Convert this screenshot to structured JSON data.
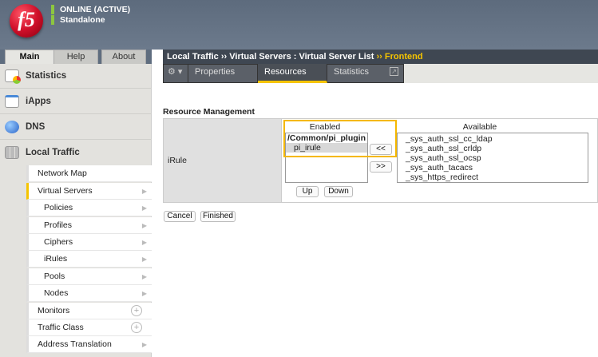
{
  "header": {
    "logo": "f5",
    "status": "ONLINE (ACTIVE)",
    "mode": "Standalone",
    "status_color": "#8dc63f"
  },
  "main_tabs": [
    "Main",
    "Help",
    "About"
  ],
  "sidebar": {
    "sections": [
      "Statistics",
      "iApps",
      "DNS",
      "Local Traffic"
    ],
    "local_traffic_items": [
      {
        "label": "Network Map"
      },
      {
        "label": "Virtual Servers"
      },
      {
        "label": "Policies"
      },
      {
        "label": "Profiles"
      },
      {
        "label": "Ciphers"
      },
      {
        "label": "iRules"
      },
      {
        "label": "Pools"
      },
      {
        "label": "Nodes"
      },
      {
        "label": "Monitors"
      },
      {
        "label": "Traffic Class"
      },
      {
        "label": "Address Translation"
      }
    ]
  },
  "breadcrumb": {
    "part1": "Local Traffic",
    "sep": "››",
    "part2": "Virtual Servers : Virtual Server List",
    "current": "Frontend"
  },
  "content_tabs": [
    "Properties",
    "Resources",
    "Statistics"
  ],
  "resource": {
    "title": "Resource Management",
    "row_label": "iRule",
    "enabled_label": "Enabled",
    "available_label": "Available",
    "enabled_group": "/Common/pi_plugin",
    "enabled_items": [
      "pi_irule"
    ],
    "available_items": [
      "_sys_auth_ssl_cc_ldap",
      "_sys_auth_ssl_crldp",
      "_sys_auth_ssl_ocsp",
      "_sys_auth_tacacs",
      "_sys_https_redirect"
    ],
    "move_left": "<<",
    "move_right": ">>",
    "up": "Up",
    "down": "Down"
  },
  "actions": {
    "cancel": "Cancel",
    "finished": "Finished"
  },
  "accent": "#f5c400"
}
